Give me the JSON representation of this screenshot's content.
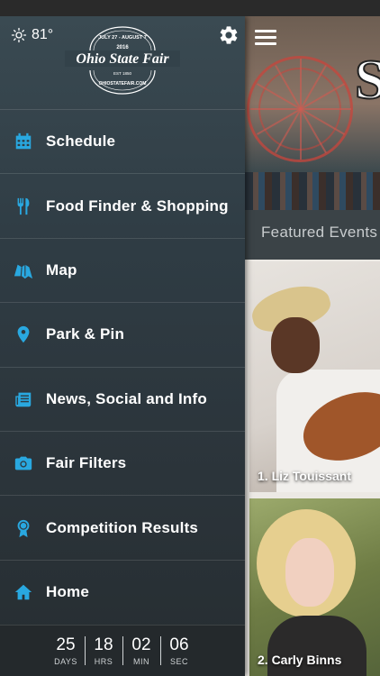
{
  "app": {
    "name": "Ohio State Fair",
    "accent": "#29a8e0"
  },
  "weather": {
    "temperature": "81°",
    "icon": "sun-icon"
  },
  "logo": {
    "top_text": "JULY 27 - AUGUST 7",
    "year": "2016",
    "title": "Ohio State Fair",
    "est": "EST 1850",
    "url": "OHIOSTATEFAIR.COM"
  },
  "menu": {
    "items": [
      {
        "label": "Schedule",
        "icon": "calendar-icon"
      },
      {
        "label": "Food Finder & Shopping",
        "icon": "fork-knife-icon"
      },
      {
        "label": "Map",
        "icon": "map-icon"
      },
      {
        "label": "Park & Pin",
        "icon": "location-pin-icon"
      },
      {
        "label": "News, Social and Info",
        "icon": "newspaper-icon"
      },
      {
        "label": "Fair Filters",
        "icon": "camera-icon"
      },
      {
        "label": "Competition Results",
        "icon": "ribbon-icon"
      },
      {
        "label": "Home",
        "icon": "home-icon"
      }
    ]
  },
  "countdown": {
    "days": {
      "value": "25",
      "label": "DAYS"
    },
    "hours": {
      "value": "18",
      "label": "HRS"
    },
    "minutes": {
      "value": "02",
      "label": "MIN"
    },
    "seconds": {
      "value": "06",
      "label": "SEC"
    }
  },
  "main": {
    "featured_header": "Featured Events",
    "events": [
      {
        "caption": "1. Liz Touissant"
      },
      {
        "caption": "2. Carly Binns"
      }
    ]
  }
}
